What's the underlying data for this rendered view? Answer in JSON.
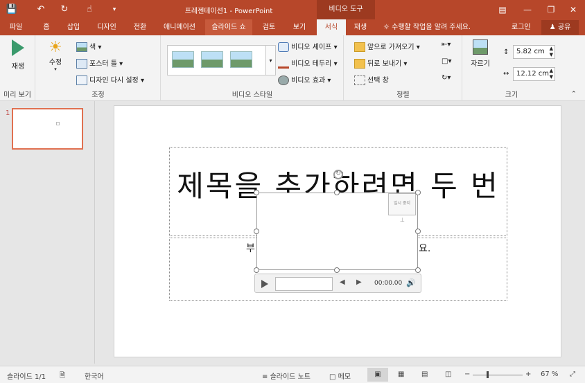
{
  "titlebar": {
    "document_title": "프레젠테이션1 - PowerPoint",
    "context_tool": "비디오 도구"
  },
  "tabs": [
    {
      "label": "파일"
    },
    {
      "label": "홈"
    },
    {
      "label": "삽입"
    },
    {
      "label": "디자인"
    },
    {
      "label": "전환"
    },
    {
      "label": "애니메이션"
    },
    {
      "label": "슬라이드 쇼"
    },
    {
      "label": "검토"
    },
    {
      "label": "보기"
    },
    {
      "label": "서식"
    },
    {
      "label": "재생"
    }
  ],
  "tellme": "수행할 작업을 알려 주세요.",
  "login": "로그인",
  "share": "공유",
  "ribbon": {
    "preview": {
      "play": "재생",
      "group": "미리 보기"
    },
    "adjust": {
      "correct": "수정",
      "color": "색",
      "poster": "포스터 틀",
      "reset": "디자인 다시 설정",
      "group": "조정"
    },
    "styles": {
      "shape": "비디오 셰이프",
      "border": "비디오 테두리",
      "effects": "비디오 효과",
      "group": "비디오 스타일"
    },
    "arrange": {
      "bring_forward": "앞으로 가져오기",
      "send_backward": "뒤로 보내기",
      "selection": "선택 창",
      "group": "정렬"
    },
    "size": {
      "crop": "자르기",
      "height": "5.82 cm",
      "width": "12.12 cm",
      "group": "크기"
    }
  },
  "slide_panel": {
    "number": "1"
  },
  "slide": {
    "title": "제목을 추가하려면 두 번",
    "subtitle_left": "부",
    "subtitle_right": "요.",
    "video_label": "일시 중지",
    "time": "00:00.00"
  },
  "status": {
    "slide": "슬라이드 1/1",
    "language": "한국어",
    "notes": "슬라이드 노트",
    "comments": "메모",
    "zoom": "67 %"
  },
  "colors": {
    "accent": "#b7472a"
  }
}
